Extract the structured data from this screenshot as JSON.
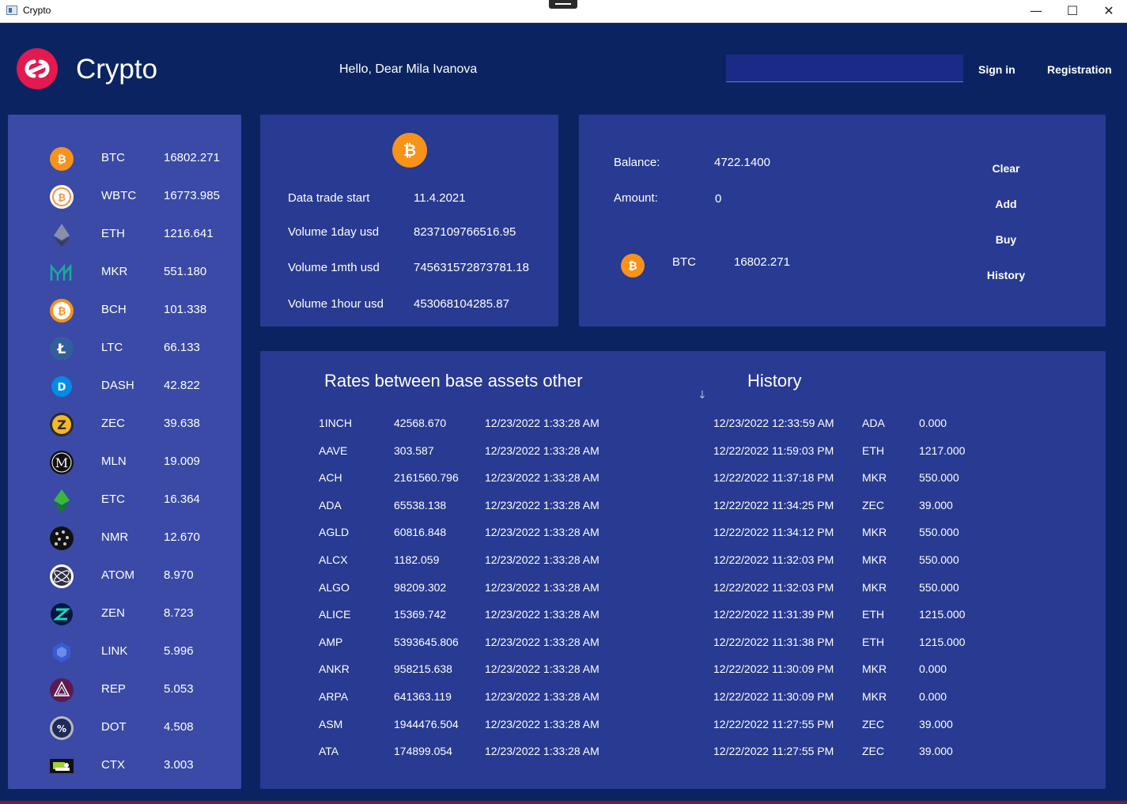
{
  "window": {
    "title": "Crypto",
    "minimize": "—",
    "maximize": "☐",
    "close": "✕"
  },
  "header": {
    "brand": "Crypto",
    "greeting": "Hello, Dear  Mila Ivanova",
    "search_value": "",
    "sign_in": "Sign in",
    "registration": "Registration"
  },
  "sidebar": {
    "coins": [
      {
        "symbol": "BTC",
        "price": "16802.271",
        "icon": "bitcoin-icon"
      },
      {
        "symbol": "WBTC",
        "price": "16773.985",
        "icon": "wrapped-bitcoin-icon"
      },
      {
        "symbol": "ETH",
        "price": "1216.641",
        "icon": "ethereum-icon"
      },
      {
        "symbol": "MKR",
        "price": "551.180",
        "icon": "maker-icon"
      },
      {
        "symbol": "BCH",
        "price": "101.338",
        "icon": "bitcoin-cash-icon"
      },
      {
        "symbol": "LTC",
        "price": "66.133",
        "icon": "litecoin-icon"
      },
      {
        "symbol": "DASH",
        "price": "42.822",
        "icon": "dash-icon"
      },
      {
        "symbol": "ZEC",
        "price": "39.638",
        "icon": "zcash-icon"
      },
      {
        "symbol": "MLN",
        "price": "19.009",
        "icon": "melon-icon"
      },
      {
        "symbol": "ETC",
        "price": "16.364",
        "icon": "ethereum-classic-icon"
      },
      {
        "symbol": "NMR",
        "price": "12.670",
        "icon": "numeraire-icon"
      },
      {
        "symbol": "ATOM",
        "price": "8.970",
        "icon": "cosmos-icon"
      },
      {
        "symbol": "ZEN",
        "price": "8.723",
        "icon": "horizen-icon"
      },
      {
        "symbol": "LINK",
        "price": "5.996",
        "icon": "chainlink-icon"
      },
      {
        "symbol": "REP",
        "price": "5.053",
        "icon": "augur-icon"
      },
      {
        "symbol": "DOT",
        "price": "4.508",
        "icon": "polkadot-icon"
      },
      {
        "symbol": "CTX",
        "price": "3.003",
        "icon": "ctx-icon"
      }
    ]
  },
  "info": {
    "icon": "bitcoin-icon",
    "rows": [
      {
        "label": "Data trade start",
        "value": "11.4.2021"
      },
      {
        "label": "Volume 1day usd",
        "value": "8237109766516.95"
      },
      {
        "label": "Volume 1mth usd",
        "value": "745631572873781.18"
      },
      {
        "label": "Volume 1hour usd",
        "value": "453068104285.87"
      }
    ]
  },
  "trade": {
    "balance_label": "Balance:",
    "balance_value": "4722.1400",
    "amount_label": "Amount:",
    "amount_value": "0",
    "selected_symbol": "BTC",
    "selected_price": "16802.271",
    "buttons": {
      "clear": "Clear",
      "add": "Add",
      "buy": "Buy",
      "history": "History"
    }
  },
  "rates": {
    "title": "Rates between base assets other",
    "history_title": "History",
    "sort_icon": "arrow-down-icon",
    "rows": [
      {
        "asset": "1INCH",
        "rate": "42568.670",
        "time": "12/23/2022 1:33:28 AM"
      },
      {
        "asset": "AAVE",
        "rate": "303.587",
        "time": "12/23/2022 1:33:28 AM"
      },
      {
        "asset": "ACH",
        "rate": "2161560.796",
        "time": "12/23/2022 1:33:28 AM"
      },
      {
        "asset": "ADA",
        "rate": "65538.138",
        "time": "12/23/2022 1:33:28 AM"
      },
      {
        "asset": "AGLD",
        "rate": "60816.848",
        "time": "12/23/2022 1:33:28 AM"
      },
      {
        "asset": "ALCX",
        "rate": "1182.059",
        "time": "12/23/2022 1:33:28 AM"
      },
      {
        "asset": "ALGO",
        "rate": "98209.302",
        "time": "12/23/2022 1:33:28 AM"
      },
      {
        "asset": "ALICE",
        "rate": "15369.742",
        "time": "12/23/2022 1:33:28 AM"
      },
      {
        "asset": "AMP",
        "rate": "5393645.806",
        "time": "12/23/2022 1:33:28 AM"
      },
      {
        "asset": "ANKR",
        "rate": "958215.638",
        "time": "12/23/2022 1:33:28 AM"
      },
      {
        "asset": "ARPA",
        "rate": "641363.119",
        "time": "12/23/2022 1:33:28 AM"
      },
      {
        "asset": "ASM",
        "rate": "1944476.504",
        "time": "12/23/2022 1:33:28 AM"
      },
      {
        "asset": "ATA",
        "rate": "174899.054",
        "time": "12/23/2022 1:33:28 AM"
      }
    ],
    "history": [
      {
        "time": "12/23/2022 12:33:59 AM",
        "asset": "ADA",
        "amount": "0.000"
      },
      {
        "time": "12/22/2022 11:59:03 PM",
        "asset": "ETH",
        "amount": "1217.000"
      },
      {
        "time": "12/22/2022 11:37:18 PM",
        "asset": "MKR",
        "amount": "550.000"
      },
      {
        "time": "12/22/2022 11:34:25 PM",
        "asset": "ZEC",
        "amount": "39.000"
      },
      {
        "time": "12/22/2022 11:34:12 PM",
        "asset": "MKR",
        "amount": "550.000"
      },
      {
        "time": "12/22/2022 11:32:03 PM",
        "asset": "MKR",
        "amount": "550.000"
      },
      {
        "time": "12/22/2022 11:32:03 PM",
        "asset": "MKR",
        "amount": "550.000"
      },
      {
        "time": "12/22/2022 11:31:39 PM",
        "asset": "ETH",
        "amount": "1215.000"
      },
      {
        "time": "12/22/2022 11:31:38 PM",
        "asset": "ETH",
        "amount": "1215.000"
      },
      {
        "time": "12/22/2022 11:30:09 PM",
        "asset": "MKR",
        "amount": "0.000"
      },
      {
        "time": "12/22/2022 11:30:09 PM",
        "asset": "MKR",
        "amount": "0.000"
      },
      {
        "time": "12/22/2022 11:27:55 PM",
        "asset": "ZEC",
        "amount": "39.000"
      },
      {
        "time": "12/22/2022 11:27:55 PM",
        "asset": "ZEC",
        "amount": "39.000"
      }
    ]
  },
  "colors": {
    "background": "#0b2461",
    "panel": "#283a91",
    "sidebar": "#3a4aa6",
    "accent": "#e3194f",
    "bitcoin": "#f7931a"
  }
}
